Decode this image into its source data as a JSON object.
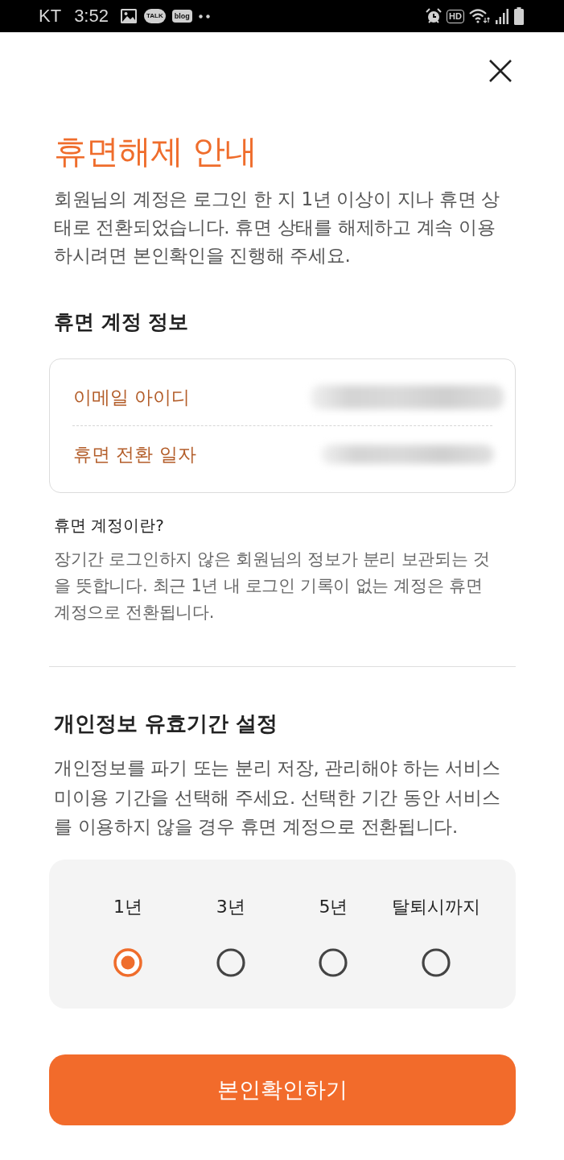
{
  "status_bar": {
    "carrier": "KT",
    "time": "3:52",
    "notification_labels": [
      "TALK",
      "blog"
    ],
    "hd_label": "HD"
  },
  "dialog": {
    "title": "휴면해제 안내",
    "intro": "회원님의 계정은 로그인 한 지 1년 이상이 지나 휴면 상태로 전환되었습니다. 휴면 상태를 해제하고 계속 이용하시려면 본인확인을 진행해 주세요."
  },
  "account_info": {
    "heading": "휴면 계정 정보",
    "rows": [
      {
        "label": "이메일 아이디"
      },
      {
        "label": "휴면 전환 일자"
      }
    ]
  },
  "dormant_info": {
    "question": "휴면 계정이란?",
    "text": "장기간 로그인하지 않은 회원님의 정보가 분리 보관되는 것을 뜻합니다. 최근 1년 내 로그인 기록이 없는 계정은 휴면 계정으로 전환됩니다."
  },
  "retention": {
    "heading": "개인정보 유효기간 설정",
    "text": "개인정보를 파기 또는 분리 저장, 관리해야 하는 서비스 미이용 기간을 선택해 주세요. 선택한 기간 동안 서비스를 이용하지 않을 경우 휴면 계정으로 전환됩니다.",
    "options": [
      {
        "label": "1년",
        "selected": true
      },
      {
        "label": "3년",
        "selected": false
      },
      {
        "label": "5년",
        "selected": false
      },
      {
        "label": "탈퇴시까지",
        "selected": false
      }
    ]
  },
  "confirm_button": "본인확인하기"
}
